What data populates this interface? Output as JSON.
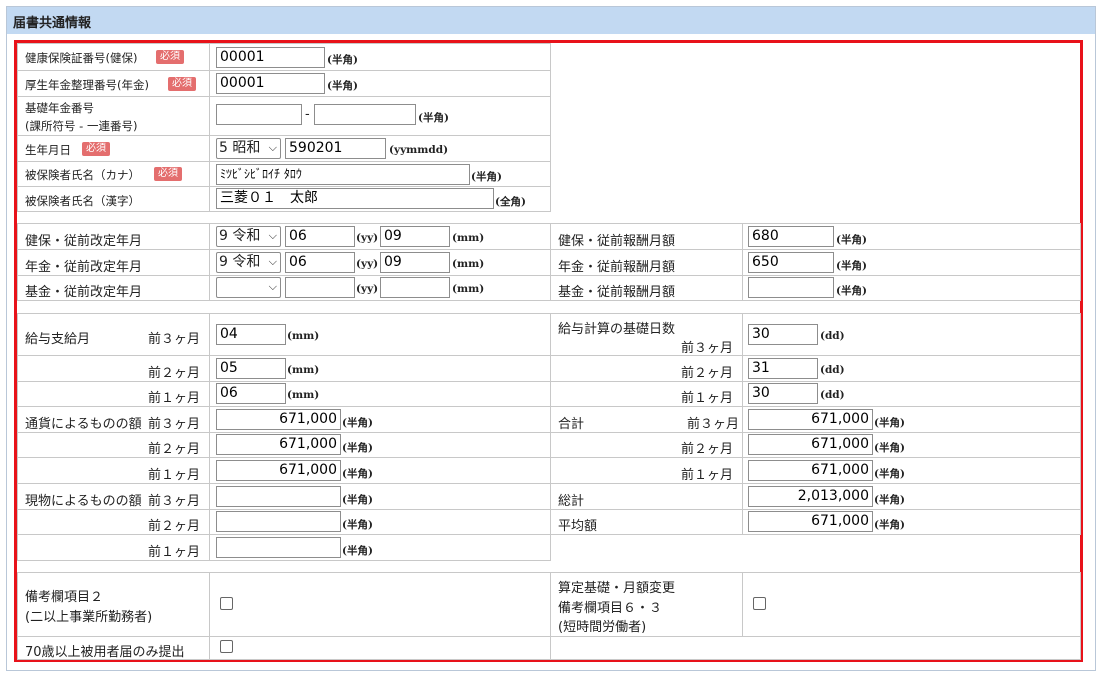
{
  "section_title": "届書共通情報",
  "required_badge": "必須",
  "units": {
    "hankaku": "(半角)",
    "zenkaku": "(全角)",
    "yymmdd": "(yymmdd)",
    "yy": "(yy)",
    "mm": "(mm)",
    "dd": "(dd)"
  },
  "top": {
    "kenpo_no": {
      "label": "健康保険証番号(健保)",
      "value": "00001"
    },
    "nenkin_no": {
      "label": "厚生年金整理番号(年金)",
      "value": "00001"
    },
    "kiso_no": {
      "label_line1": "基礎年金番号",
      "label_line2": "(課所符号 - 一連番号)",
      "value1": "",
      "value2": "",
      "separator": "-"
    },
    "birth": {
      "label": "生年月日",
      "era": "5 昭和",
      "value": "590201"
    },
    "kana_name": {
      "label": "被保険者氏名（カナ）",
      "value": "ﾐﾂﾋﾞｼﾋﾞﾛｲﾁ ﾀﾛｳ"
    },
    "kanji_name": {
      "label": "被保険者氏名（漢字）",
      "value": "三菱０１　太郎"
    }
  },
  "revision": {
    "kenpo": {
      "label": "健保・従前改定年月",
      "era": "9 令和",
      "yy": "06",
      "mm": "09",
      "pay_label": "健保・従前報酬月額",
      "pay": "680"
    },
    "nenkin": {
      "label": "年金・従前改定年月",
      "era": "9 令和",
      "yy": "06",
      "mm": "09",
      "pay_label": "年金・従前報酬月額",
      "pay": "650"
    },
    "kikin": {
      "label": "基金・従前改定年月",
      "era": "",
      "yy": "",
      "mm": "",
      "pay_label": "基金・従前報酬月額",
      "pay": ""
    }
  },
  "wages": {
    "label_month": "給与支給月",
    "label_days_line1": "給与計算の基礎日数",
    "label_currency": "通貨によるものの額",
    "label_total": "合計",
    "label_kind": "現物によるものの額",
    "label_grand_total": "総計",
    "label_average": "平均額",
    "m3": "前３ヶ月",
    "m2": "前２ヶ月",
    "m1": "前１ヶ月",
    "month": [
      "04",
      "05",
      "06"
    ],
    "days": [
      "30",
      "31",
      "30"
    ],
    "currency": [
      "671,000",
      "671,000",
      "671,000"
    ],
    "total": [
      "671,000",
      "671,000",
      "671,000"
    ],
    "kind": [
      "",
      "",
      ""
    ],
    "grand_total": "2,013,000",
    "average": "671,000"
  },
  "remarks": {
    "item2_line1": "備考欄項目２",
    "item2_line2": "(二以上事業所勤務者)",
    "item63_line1": "算定基礎・月額変更",
    "item63_line2": "備考欄項目６・３",
    "item63_line3": "(短時間労働者)",
    "over70": "70歳以上被用者届のみ提出"
  }
}
